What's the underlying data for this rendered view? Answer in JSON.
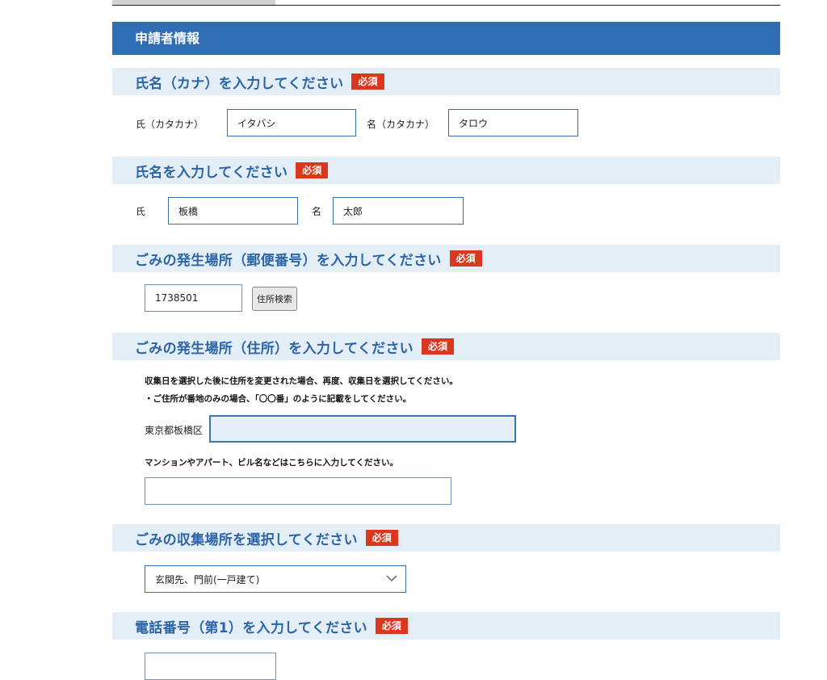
{
  "section_header": "申請者情報",
  "required_badge": "必須",
  "name_kana": {
    "title": "氏名（カナ）を入力してください",
    "last_label": "氏（カタカナ）",
    "last_value": "イタバシ",
    "first_label": "名（カタカナ）",
    "first_value": "タロウ"
  },
  "name": {
    "title": "氏名を入力してください",
    "last_label": "氏",
    "last_value": "板橋",
    "first_label": "名",
    "first_value": "太郎"
  },
  "postal": {
    "title": "ごみの発生場所（郵便番号）を入力してください",
    "value": "1738501",
    "search_button": "住所検索"
  },
  "address": {
    "title": "ごみの発生場所（住所）を入力してください",
    "note1": "収集日を選択した後に住所を変更された場合、再度、収集日を選択してください。",
    "note2": "・ご住所が番地のみの場合、「〇〇番」のように記載をしてください。",
    "prefix": "東京都板橋区",
    "value": "",
    "building_note": "マンションやアパート、ビル名などはこちらに入力してください。",
    "building_value": ""
  },
  "collection": {
    "title": "ごみの収集場所を選択してください",
    "selected": "玄関先、門前(一戸建て)"
  },
  "phone": {
    "title": "電話番号（第1）を入力してください"
  },
  "colors": {
    "header_bg": "#2f6db5",
    "question_bg": "#e4eef7",
    "question_text": "#2c64a6",
    "required_bg": "#d9381e"
  }
}
